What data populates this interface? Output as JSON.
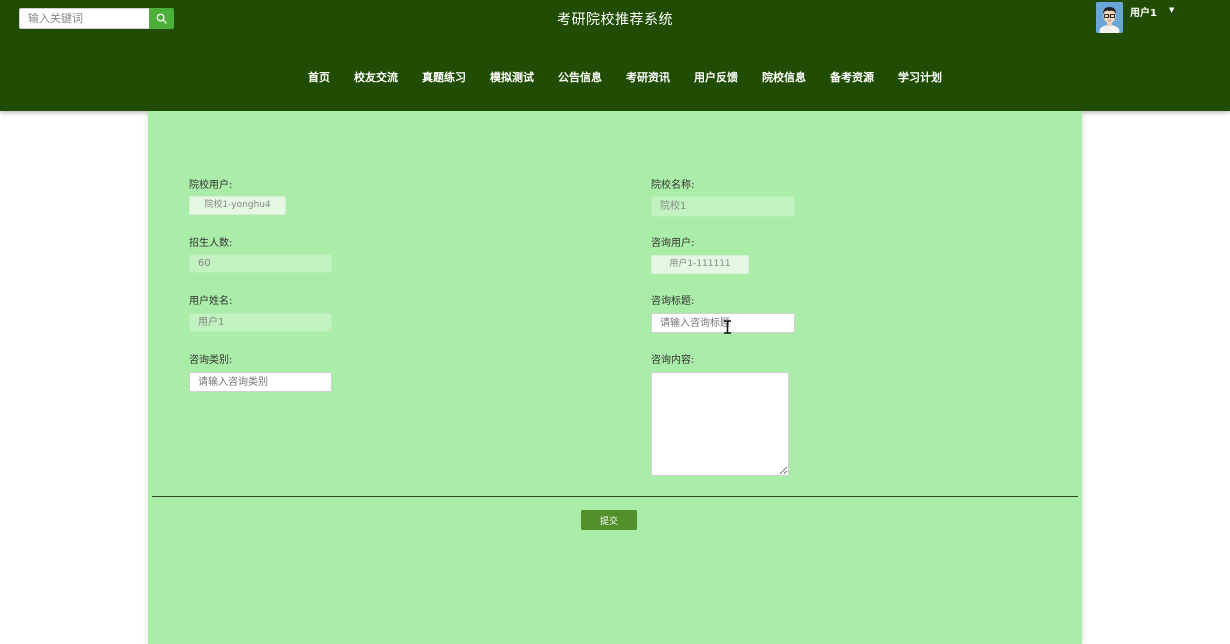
{
  "header": {
    "search_placeholder": "输入关键词",
    "site_title": "考研院校推荐系统",
    "user_name": "用户1",
    "caret": "▼"
  },
  "nav": {
    "items": [
      "首页",
      "校友交流",
      "真题练习",
      "模拟测试",
      "公告信息",
      "考研资讯",
      "用户反馈",
      "院校信息",
      "备考资源",
      "学习计划"
    ]
  },
  "form": {
    "school_user": {
      "label": "院校用户:",
      "value": "院校1-yonghu4"
    },
    "school_name": {
      "label": "院校名称:",
      "value": "院校1"
    },
    "enroll_count": {
      "label": "招生人数:",
      "value": "60"
    },
    "consult_user": {
      "label": "咨询用户:",
      "value": "用户1-111111"
    },
    "user_name": {
      "label": "用户姓名:",
      "value": "用户1"
    },
    "consult_title": {
      "label": "咨询标题:",
      "placeholder": "请输入咨询标题"
    },
    "consult_category": {
      "label": "咨询类别:",
      "placeholder": "请输入咨询类别"
    },
    "consult_content": {
      "label": "咨询内容:"
    },
    "submit_label": "提交"
  },
  "colors": {
    "header_bg": "#204d03",
    "panel_bg": "#aaeda8",
    "accent": "#53902c",
    "search_button": "#4caf39"
  }
}
